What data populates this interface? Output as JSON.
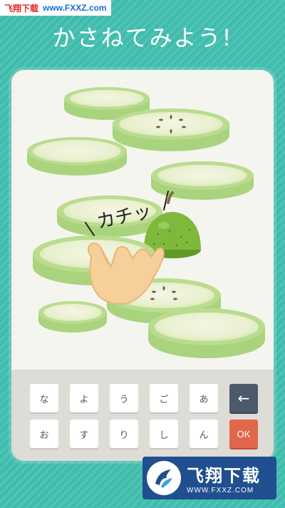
{
  "watermark_top": {
    "name": "飞翔下载",
    "url": "www.FXXZ.com"
  },
  "title": "かさねてみよう!",
  "sound_effect": "カチッ",
  "keypad": {
    "rows": [
      [
        "な",
        "よ",
        "う",
        "ご",
        "あ"
      ],
      [
        "お",
        "す",
        "り",
        "し",
        "ん"
      ]
    ],
    "back_icon": "←",
    "ok_label": "OK"
  },
  "watermark_bottom": {
    "name": "飞翔下载",
    "url": "WWW.FXXZ.COM"
  },
  "colors": {
    "background": "#3fbcad",
    "board": "#f5f5f0",
    "slice_edge": "#b9dc8f",
    "slice_center": "#eef3d9",
    "pear": "#7fb93c",
    "back_key": "#4d5a6c",
    "ok_key": "#e2674a"
  }
}
